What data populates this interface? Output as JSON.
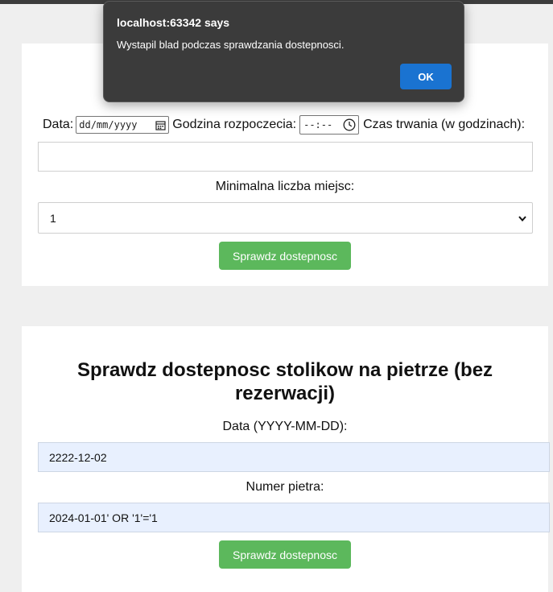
{
  "dialog": {
    "title": "localhost:63342 says",
    "message": "Wystapil blad podczas sprawdzania dostepnosci.",
    "ok_label": "OK"
  },
  "form1": {
    "date_label": "Data:",
    "date_placeholder": "dd/mm/yyyy",
    "start_label": "Godzina rozpoczecia:",
    "time_placeholder": "--:--",
    "duration_label": "Czas trwania (w godzinach):",
    "min_seats_label": "Minimalna liczba miejsc:",
    "min_seats_value": "1",
    "button_label": "Sprawdz dostepnosc"
  },
  "form2": {
    "title": "Sprawdz dostepnosc stolikow na pietrze (bez rezerwacji)",
    "date_label": "Data (YYYY-MM-DD):",
    "date_value": "2222-12-02",
    "floor_label": "Numer pietra:",
    "floor_value": "2024-01-01' OR '1'='1",
    "button_label": "Sprawdz dostepnosc"
  }
}
